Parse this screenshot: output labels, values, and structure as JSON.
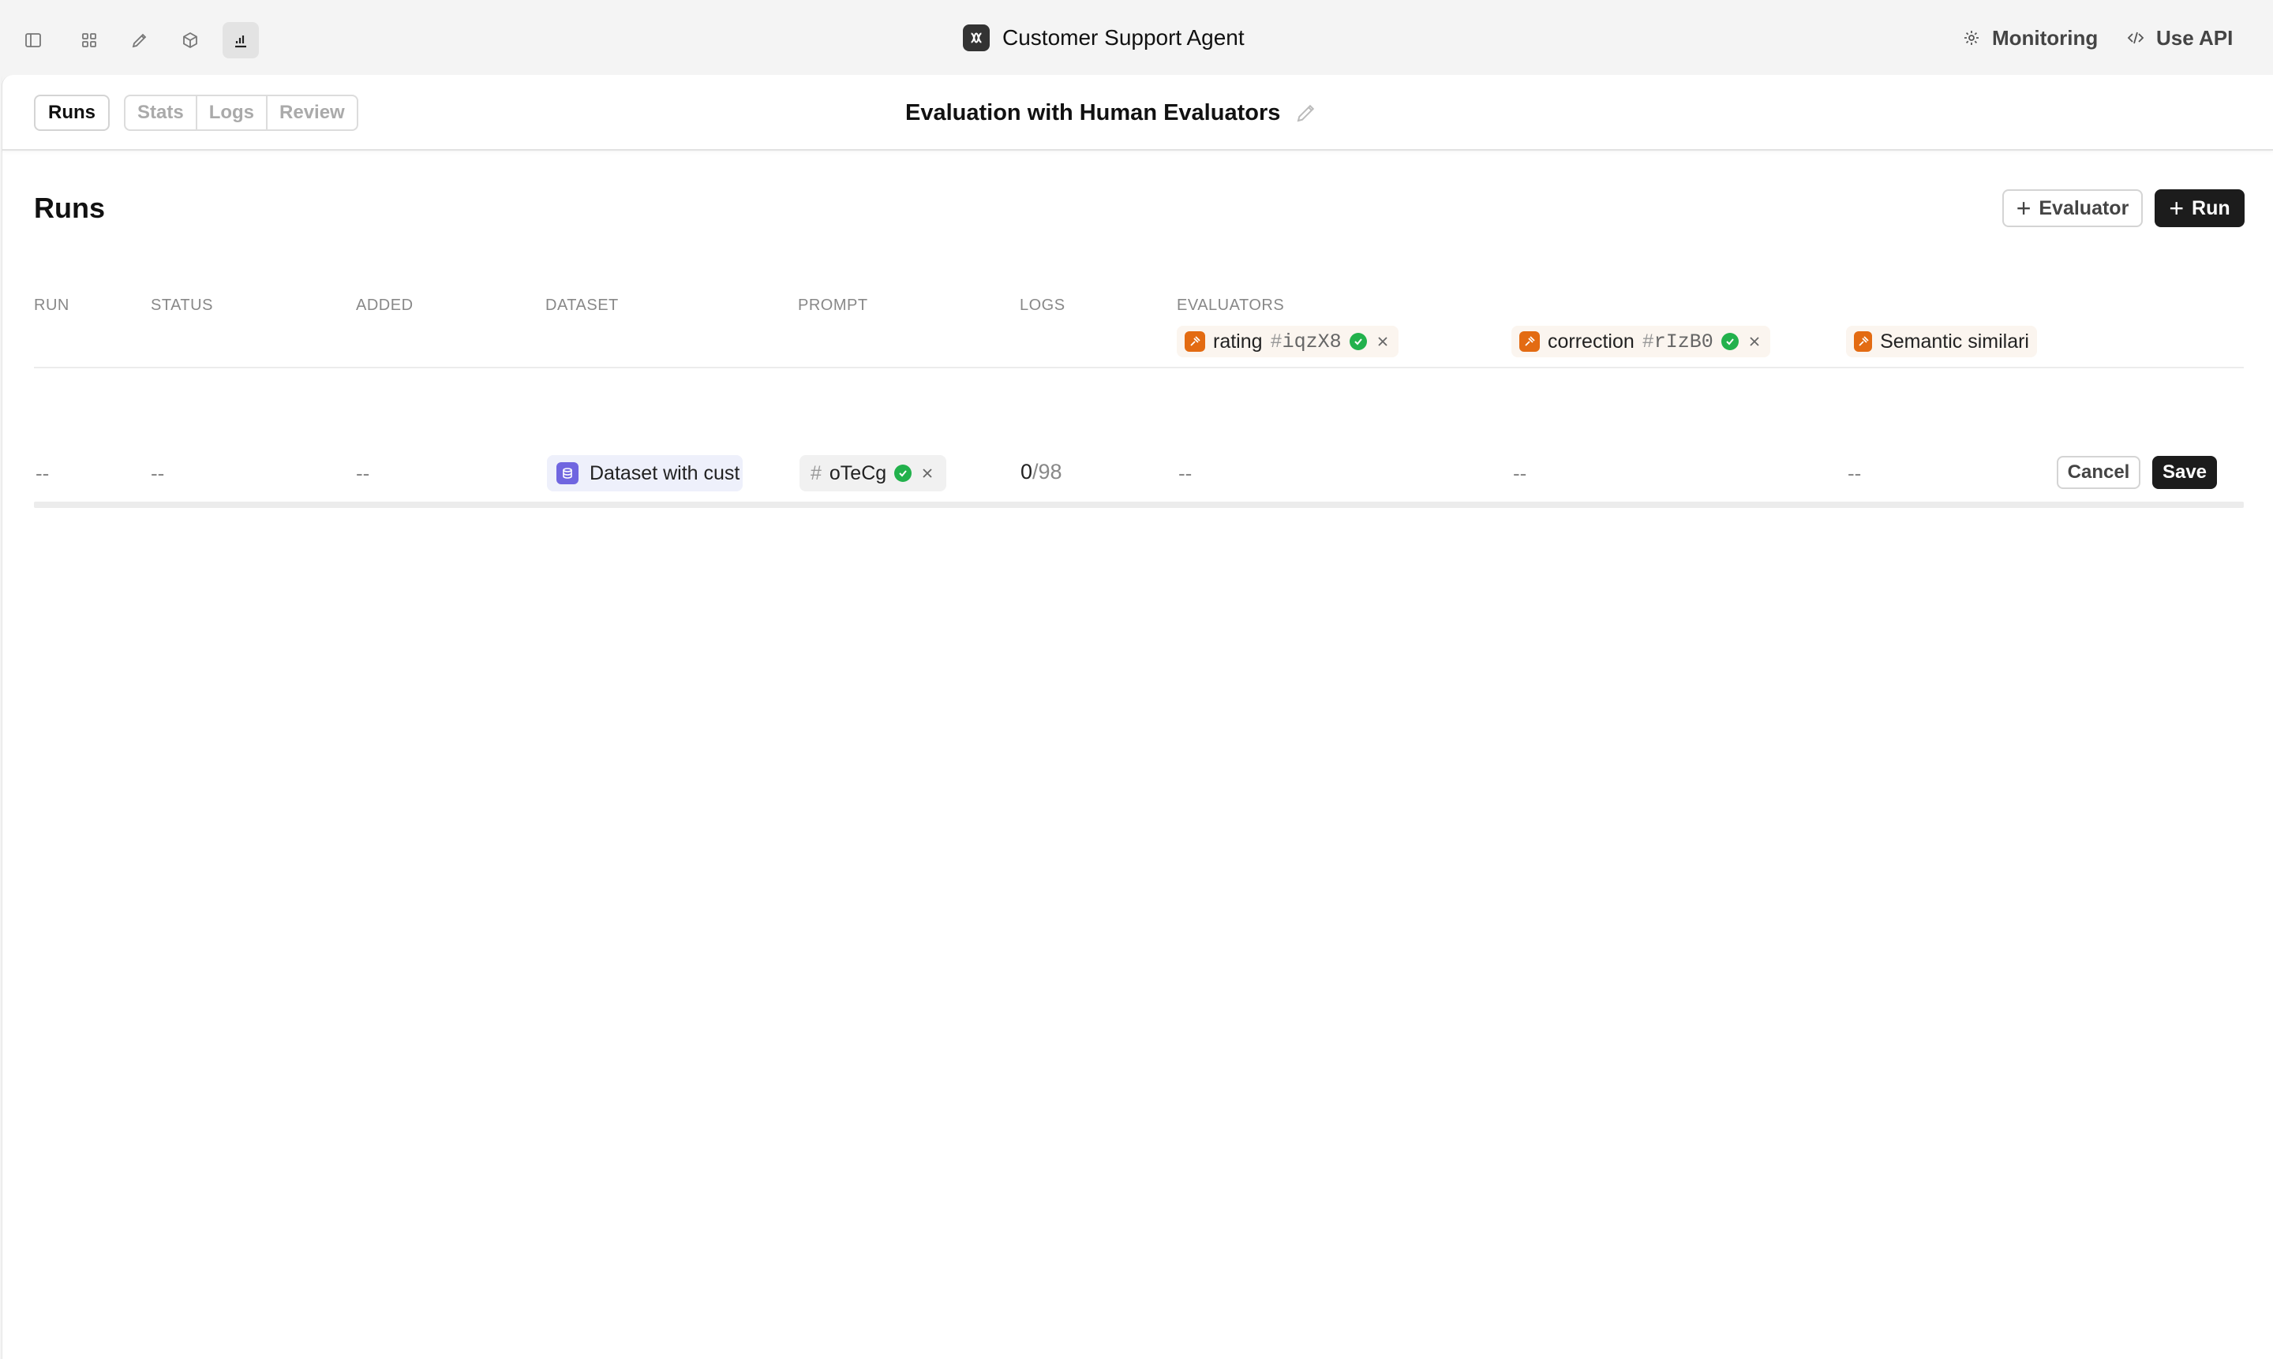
{
  "topbar": {
    "app_title": "Customer Support Agent",
    "monitoring_label": "Monitoring",
    "use_api_label": "Use API",
    "icons": [
      "sidebar-toggle-icon",
      "grid-icon",
      "pencil-icon",
      "cube-icon",
      "bar-chart-icon"
    ]
  },
  "subheader": {
    "active_tab": "Runs",
    "tabs": [
      "Stats",
      "Logs",
      "Review"
    ],
    "title": "Evaluation with Human Evaluators"
  },
  "main": {
    "section_title": "Runs",
    "evaluator_button": "Evaluator",
    "run_button": "Run"
  },
  "table": {
    "headers": {
      "run": "RUN",
      "status": "STATUS",
      "added": "ADDED",
      "dataset": "DATASET",
      "prompt": "PROMPT",
      "logs": "LOGS",
      "evaluators": "EVALUATORS"
    },
    "evaluators": [
      {
        "name": "rating",
        "hash": "iqzX8"
      },
      {
        "name": "correction",
        "hash": "rIzB0"
      },
      {
        "name": "Semantic similari"
      }
    ],
    "row": {
      "run": "--",
      "status": "--",
      "added": "--",
      "dataset": "Dataset with cust",
      "prompt_hash": "oTeCg",
      "logs_done": "0",
      "logs_total": "/98",
      "eval_values": [
        "--",
        "--",
        "--"
      ],
      "cancel_label": "Cancel",
      "save_label": "Save"
    },
    "hash_symbol": "#"
  },
  "colors": {
    "evaluator_orange": "#e36b12",
    "dataset_purple": "#7066e0",
    "check_green": "#22b14c",
    "primary_dark": "#1c1c1c"
  }
}
